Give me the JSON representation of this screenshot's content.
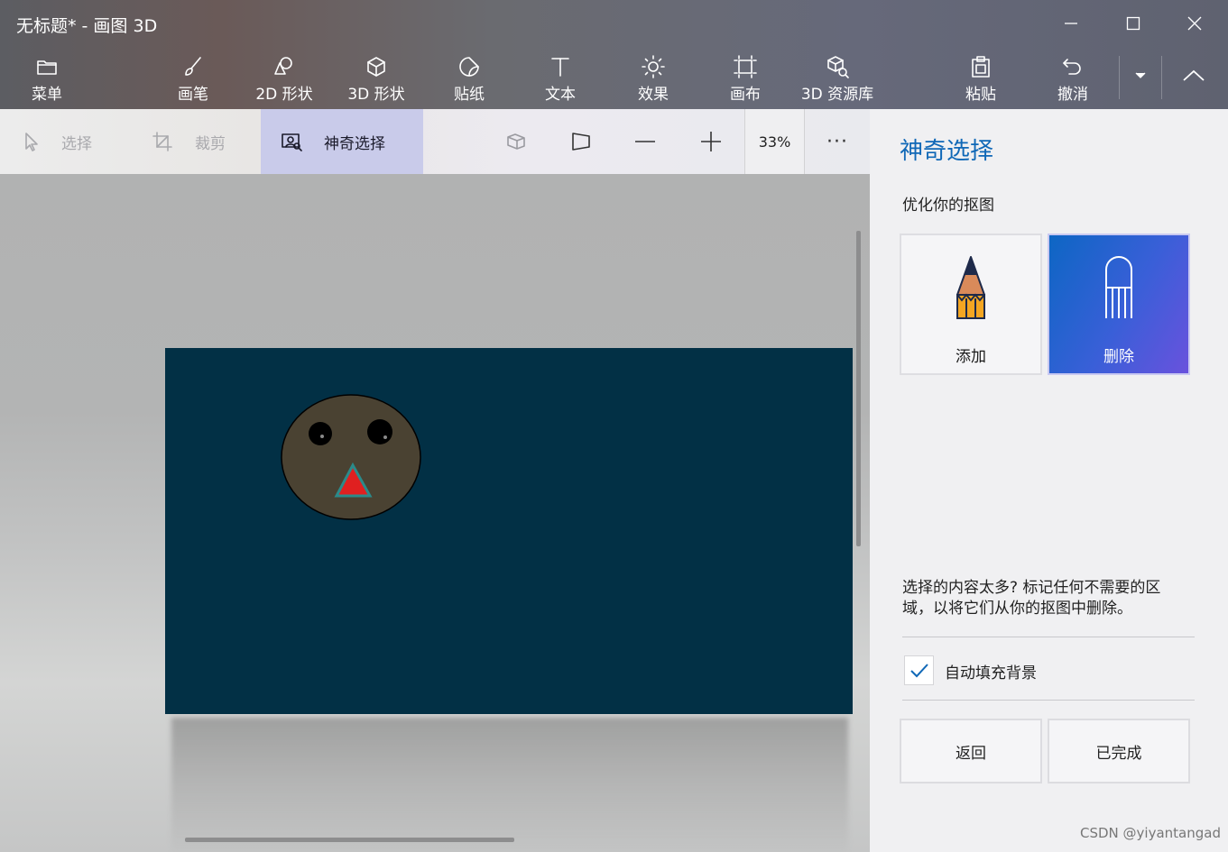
{
  "window": {
    "title": "无标题* - 画图 3D",
    "minimize_icon": "minimize-icon",
    "maximize_icon": "maximize-icon",
    "close_icon": "close-icon"
  },
  "toolbar": {
    "menu": "菜单",
    "brush": "画笔",
    "shapes2d": "2D 形状",
    "shapes3d": "3D 形状",
    "stickers": "贴纸",
    "text": "文本",
    "effects": "效果",
    "canvas": "画布",
    "library3d": "3D 资源库",
    "paste": "粘贴",
    "undo": "撤消"
  },
  "subbar": {
    "select": "选择",
    "crop": "裁剪",
    "magic_select": "神奇选择",
    "zoom": "33%",
    "more": "···"
  },
  "panel": {
    "title": "神奇选择",
    "subtitle": "优化你的抠图",
    "add": "添加",
    "remove": "删除",
    "description": "选择的内容太多? 标记任何不需要的区域，以将它们从你的抠图中删除。",
    "autofill_label": "自动填充背景",
    "autofill_checked": true,
    "back": "返回",
    "done": "已完成"
  },
  "colors": {
    "accent": "#1068b7",
    "canvas_bg": "#023045",
    "face": "#4a4232",
    "nose": "#e02020"
  },
  "watermark": "CSDN @yiyantangad"
}
